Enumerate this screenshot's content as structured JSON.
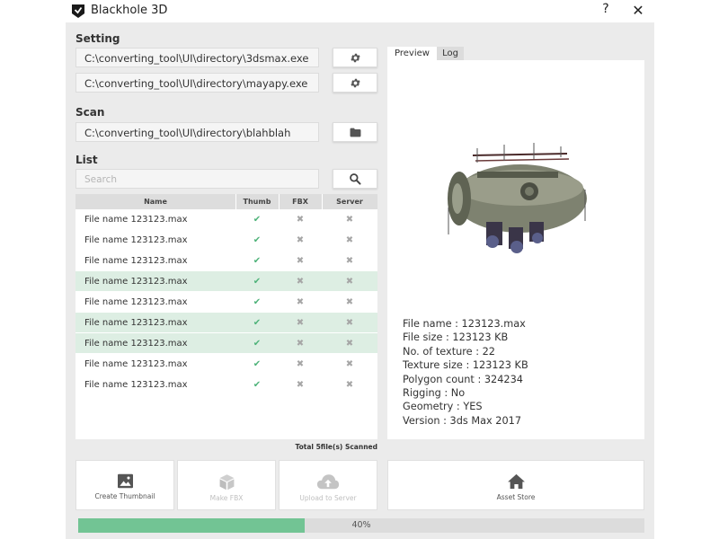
{
  "window": {
    "title": "Blackhole 3D",
    "help_label": "?",
    "close_label": "✕"
  },
  "setting": {
    "title": "Setting",
    "paths": [
      "C:\\converting_tool\\UI\\directory\\3dsmax.exe",
      "C:\\converting_tool\\UI\\directory\\mayapy.exe"
    ]
  },
  "scan": {
    "title": "Scan",
    "path": "C:\\converting_tool\\UI\\directory\\blahblah"
  },
  "list": {
    "title": "List",
    "search_placeholder": "Search",
    "columns": [
      "Name",
      "Thumb",
      "FBX",
      "Server"
    ],
    "rows": [
      {
        "name": "File name 123123.max",
        "thumb": "✔",
        "fbx": "✖",
        "server": "✖",
        "highlight": false
      },
      {
        "name": "File name 123123.max",
        "thumb": "✔",
        "fbx": "✖",
        "server": "✖",
        "highlight": false
      },
      {
        "name": "File name 123123.max",
        "thumb": "✔",
        "fbx": "✖",
        "server": "✖",
        "highlight": false
      },
      {
        "name": "File name 123123.max",
        "thumb": "✔",
        "fbx": "✖",
        "server": "✖",
        "highlight": true
      },
      {
        "name": "File name 123123.max",
        "thumb": "✔",
        "fbx": "✖",
        "server": "✖",
        "highlight": false
      },
      {
        "name": "File name 123123.max",
        "thumb": "✔",
        "fbx": "✖",
        "server": "✖",
        "highlight": true
      },
      {
        "name": "File name 123123.max",
        "thumb": "✔",
        "fbx": "✖",
        "server": "✖",
        "highlight": true
      },
      {
        "name": "File name 123123.max",
        "thumb": "✔",
        "fbx": "✖",
        "server": "✖",
        "highlight": false
      },
      {
        "name": "File name 123123.max",
        "thumb": "✔",
        "fbx": "✖",
        "server": "✖",
        "highlight": false
      }
    ],
    "total": "Total 5file(s) Scanned"
  },
  "preview": {
    "tabs": [
      "Preview",
      "Log"
    ],
    "info": [
      "File name : 123123.max",
      "File size : 123123 KB",
      "No. of texture : 22",
      "Texture size : 123123 KB",
      "Polygon count : 324234",
      "Rigging : No",
      "Geometry : YES",
      "Version : 3ds Max 2017"
    ]
  },
  "actions": {
    "create_thumbnail": "Create Thumbnail",
    "make_fbx": "Make FBX",
    "upload": "Upload to Server",
    "asset_store": "Asset Store"
  },
  "progress": {
    "value": 0.4,
    "label": "40%"
  },
  "icons": {
    "logo": "shield-logo-icon",
    "gear": "gear-icon",
    "folder": "folder-icon",
    "search": "search-icon",
    "image": "image-icon",
    "cube": "cube-icon",
    "cloud": "cloud-upload-icon",
    "home": "home-icon"
  },
  "colors": {
    "accent": "#72c494",
    "row_highlight": "#ddeee3",
    "check": "#4fb37a",
    "panel_bg": "#ebebeb"
  }
}
